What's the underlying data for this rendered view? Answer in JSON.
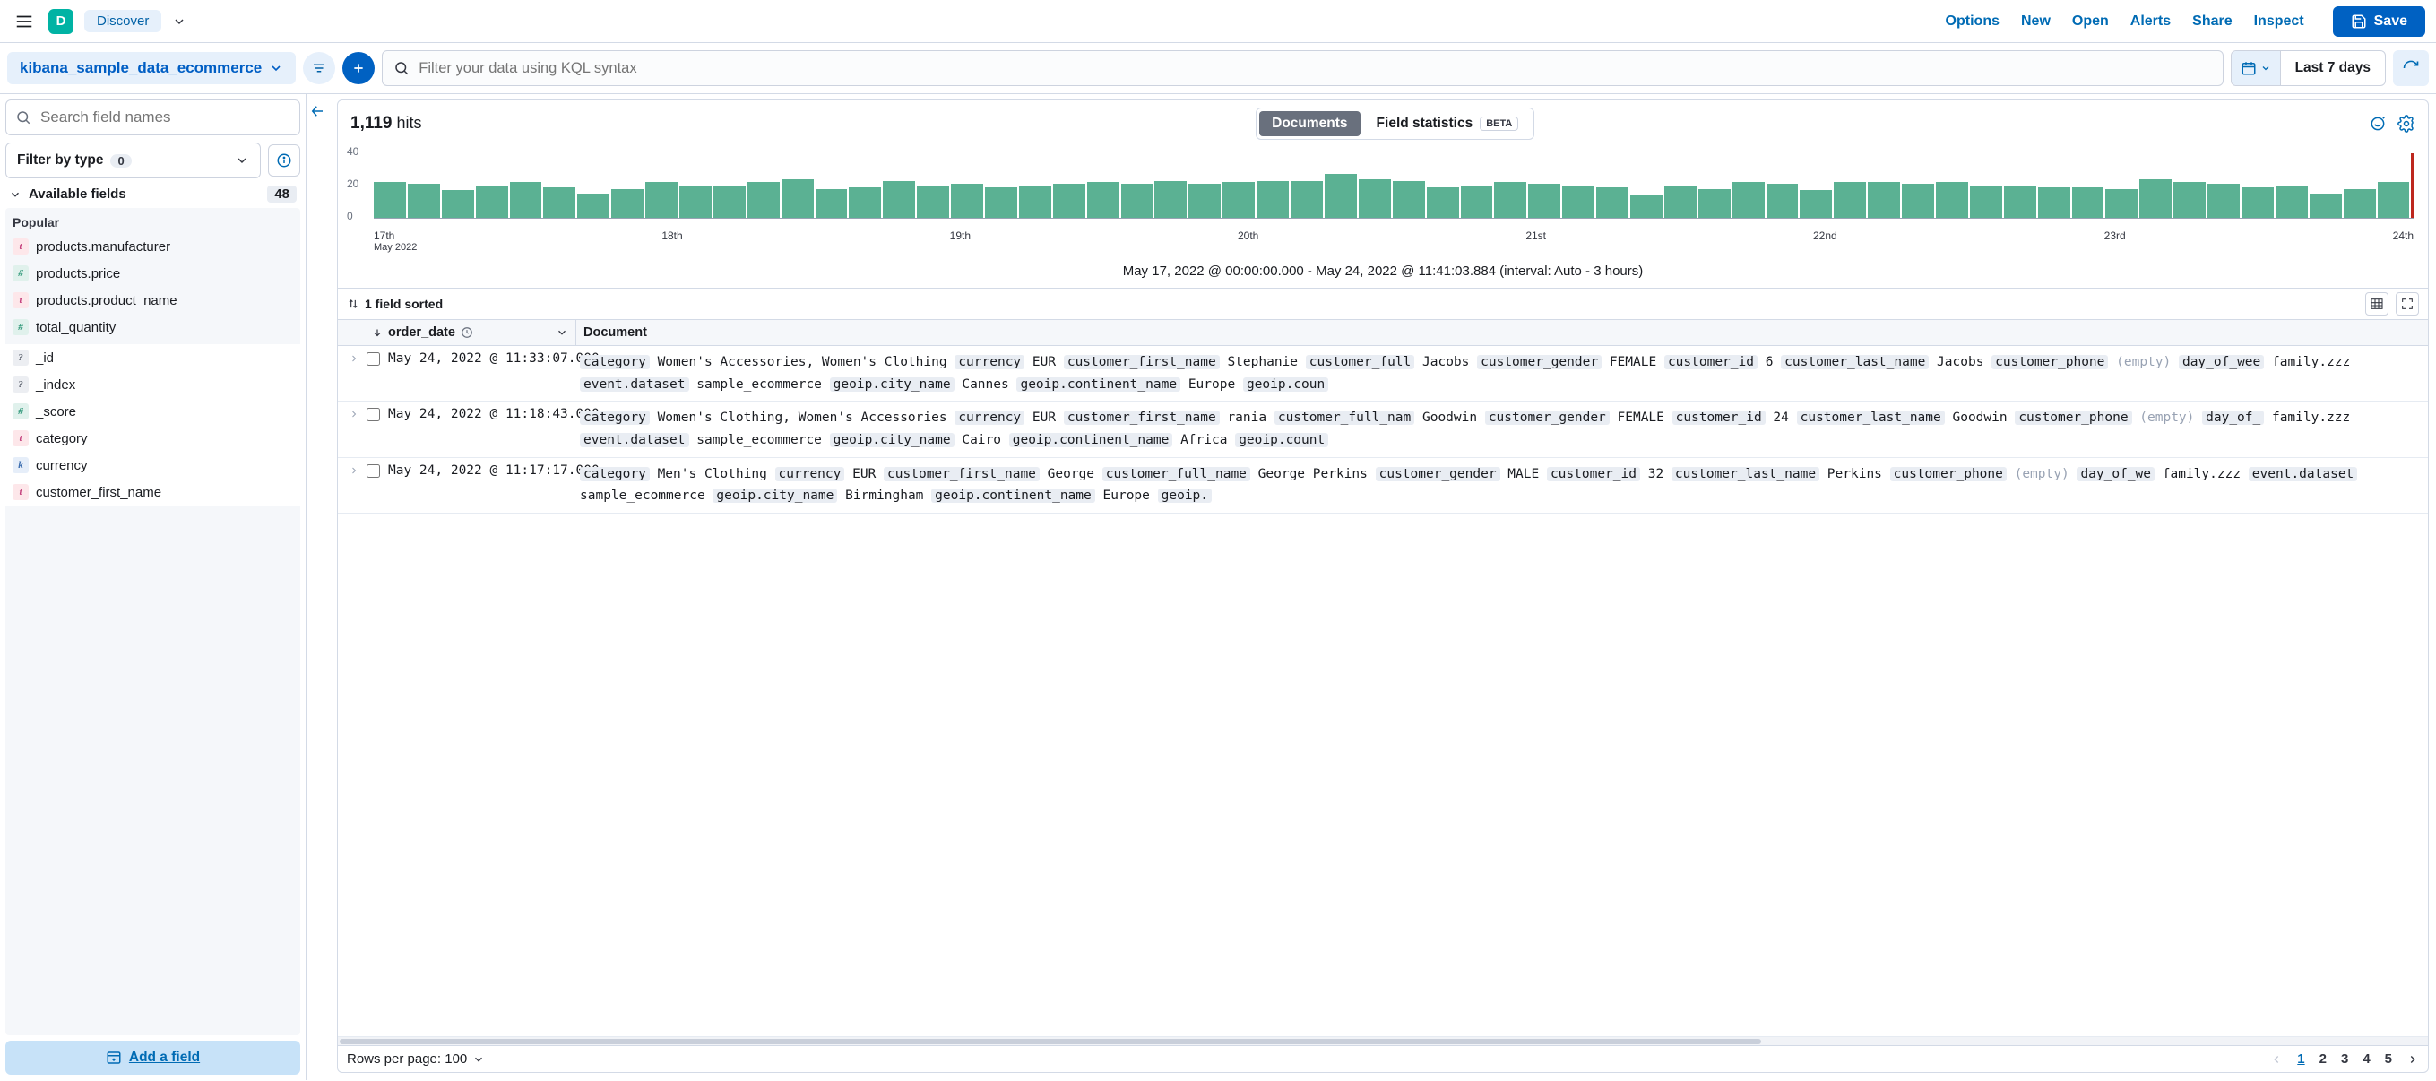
{
  "topbar": {
    "logo_letter": "D",
    "discover_label": "Discover",
    "links": [
      "Options",
      "New",
      "Open",
      "Alerts",
      "Share",
      "Inspect"
    ],
    "save_label": "Save"
  },
  "querybar": {
    "pattern": "kibana_sample_data_ecommerce",
    "kql_placeholder": "Filter your data using KQL syntax",
    "date_label": "Last 7 days"
  },
  "sidebar": {
    "field_search_placeholder": "Search field names",
    "filter_by_type_label": "Filter by type",
    "filter_by_type_count": "0",
    "available_label": "Available fields",
    "available_count": "48",
    "popular_label": "Popular",
    "popular": [
      {
        "tok": "t",
        "name": "products.manufacturer"
      },
      {
        "tok": "n",
        "name": "products.price"
      },
      {
        "tok": "t",
        "name": "products.product_name"
      },
      {
        "tok": "n",
        "name": "total_quantity"
      }
    ],
    "rest": [
      {
        "tok": "q",
        "name": "_id"
      },
      {
        "tok": "q",
        "name": "_index"
      },
      {
        "tok": "n",
        "name": "_score"
      },
      {
        "tok": "t",
        "name": "category"
      },
      {
        "tok": "k",
        "name": "currency"
      },
      {
        "tok": "t",
        "name": "customer_first_name"
      }
    ],
    "add_field_label": "Add a field"
  },
  "content": {
    "hits_number": "1,119",
    "hits_label": "hits",
    "tab_documents": "Documents",
    "tab_fieldstats": "Field statistics",
    "beta_label": "BETA",
    "histogram_range": "May 17, 2022 @ 00:00:00.000 - May 24, 2022 @ 11:41:03.884 (interval: Auto - 3 hours)",
    "fields_sorted": "1 field sorted",
    "col_order_date": "order_date",
    "col_document": "Document",
    "rows": [
      {
        "date": "May 24, 2022 @ 11:33:07.000",
        "kv": [
          [
            "category",
            "Women's Accessories, Women's Clothing"
          ],
          [
            "currency",
            "EUR"
          ],
          [
            "customer_first_name",
            "Stephanie"
          ],
          [
            "customer_full",
            "Jacobs"
          ],
          [
            "customer_gender",
            "FEMALE"
          ],
          [
            "customer_id",
            "6"
          ],
          [
            "customer_last_name",
            "Jacobs"
          ],
          [
            "customer_phone",
            "(empty)"
          ],
          [
            "day_of_wee",
            "family.zzz"
          ],
          [
            "event.dataset",
            "sample_ecommerce"
          ],
          [
            "geoip.city_name",
            "Cannes"
          ],
          [
            "geoip.continent_name",
            "Europe"
          ],
          [
            "geoip.coun",
            ""
          ]
        ]
      },
      {
        "date": "May 24, 2022 @ 11:18:43.000",
        "kv": [
          [
            "category",
            "Women's Clothing, Women's Accessories"
          ],
          [
            "currency",
            "EUR"
          ],
          [
            "customer_first_name",
            "rania"
          ],
          [
            "customer_full_nam",
            "Goodwin"
          ],
          [
            "customer_gender",
            "FEMALE"
          ],
          [
            "customer_id",
            "24"
          ],
          [
            "customer_last_name",
            "Goodwin"
          ],
          [
            "customer_phone",
            "(empty)"
          ],
          [
            "day_of_",
            "family.zzz"
          ],
          [
            "event.dataset",
            "sample_ecommerce"
          ],
          [
            "geoip.city_name",
            "Cairo"
          ],
          [
            "geoip.continent_name",
            "Africa"
          ],
          [
            "geoip.count",
            ""
          ]
        ]
      },
      {
        "date": "May 24, 2022 @ 11:17:17.000",
        "kv": [
          [
            "category",
            "Men's Clothing"
          ],
          [
            "currency",
            "EUR"
          ],
          [
            "customer_first_name",
            "George"
          ],
          [
            "customer_full_name",
            "George Perkins"
          ],
          [
            "customer_gender",
            "MALE"
          ],
          [
            "customer_id",
            "32"
          ],
          [
            "customer_last_name",
            "Perkins"
          ],
          [
            "customer_phone",
            "(empty)"
          ],
          [
            "day_of_we",
            "family.zzz"
          ],
          [
            "event.dataset",
            "sample_ecommerce"
          ],
          [
            "geoip.city_name",
            "Birmingham"
          ],
          [
            "geoip.continent_name",
            "Europe"
          ],
          [
            "geoip.",
            ""
          ]
        ]
      }
    ],
    "rows_per_page_label": "Rows per page: 100",
    "pages": [
      "1",
      "2",
      "3",
      "4",
      "5"
    ],
    "active_page": "1"
  },
  "chart_data": {
    "type": "bar",
    "title": "",
    "ylabel": "",
    "xlabel": "",
    "ylim": [
      0,
      40
    ],
    "yticks": [
      0,
      20,
      40
    ],
    "x_major_ticks": [
      "17th",
      "18th",
      "19th",
      "20th",
      "21st",
      "22nd",
      "23rd",
      "24th"
    ],
    "x_sublabel": "May 2022",
    "interval": "3 hours",
    "values": [
      22,
      21,
      17,
      20,
      22,
      19,
      15,
      18,
      22,
      20,
      20,
      22,
      24,
      18,
      19,
      23,
      20,
      21,
      19,
      20,
      21,
      22,
      21,
      23,
      21,
      22,
      23,
      23,
      27,
      24,
      23,
      19,
      20,
      22,
      21,
      20,
      19,
      14,
      20,
      18,
      22,
      21,
      17,
      22,
      22,
      21,
      22,
      20,
      20,
      19,
      19,
      18,
      24,
      22,
      21,
      19,
      20,
      15,
      18,
      22
    ],
    "cutoff_marker": true
  }
}
